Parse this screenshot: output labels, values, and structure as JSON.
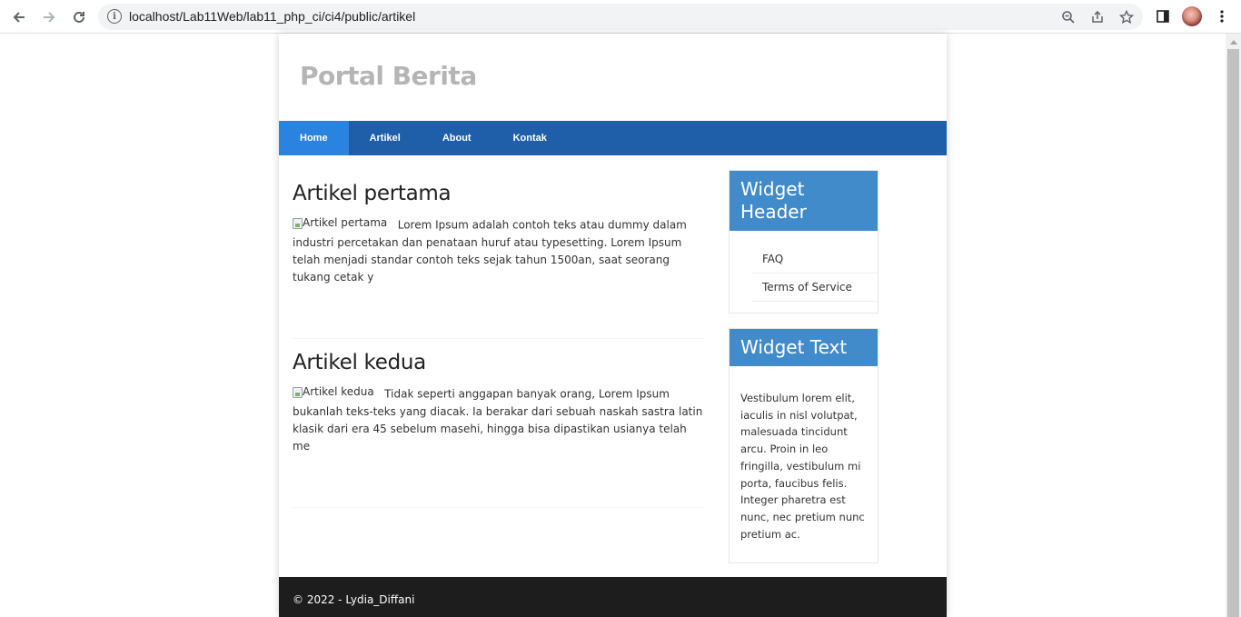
{
  "browser": {
    "url": "localhost/Lab11Web/lab11_php_ci/ci4/public/artikel"
  },
  "site": {
    "title": "Portal Berita",
    "nav": [
      {
        "label": "Home",
        "active": true
      },
      {
        "label": "Artikel",
        "active": false
      },
      {
        "label": "About",
        "active": false
      },
      {
        "label": "Kontak",
        "active": false
      }
    ]
  },
  "articles": [
    {
      "title": "Artikel pertama",
      "image_alt": "Artikel pertama",
      "body": "Lorem Ipsum adalah contoh teks atau dummy dalam industri percetakan dan penataan huruf atau typesetting. Lorem Ipsum telah menjadi standar contoh teks sejak tahun 1500an, saat seorang tukang cetak y"
    },
    {
      "title": "Artikel kedua",
      "image_alt": "Artikel kedua",
      "body": "Tidak seperti anggapan banyak orang, Lorem Ipsum bukanlah teks-teks yang diacak. Ia berakar dari sebuah naskah sastra latin klasik dari era 45 sebelum masehi, hingga bisa dipastikan usianya telah me"
    }
  ],
  "sidebar": {
    "widget1": {
      "header": "Widget Header",
      "links": [
        "FAQ",
        "Terms of Service"
      ]
    },
    "widget2": {
      "header": "Widget Text",
      "text": "Vestibulum lorem elit, iaculis in nisl volutpat, malesuada tincidunt arcu. Proin in leo fringilla, vestibulum mi porta, faucibus felis. Integer pharetra est nunc, nec pretium nunc pretium ac."
    }
  },
  "footer": {
    "text": "© 2022 - Lydia_Diffani"
  },
  "colors": {
    "nav": "#1f5faa",
    "nav_active": "#2b83e0",
    "widget_header": "#428bca",
    "footer": "#1d1d1d"
  }
}
